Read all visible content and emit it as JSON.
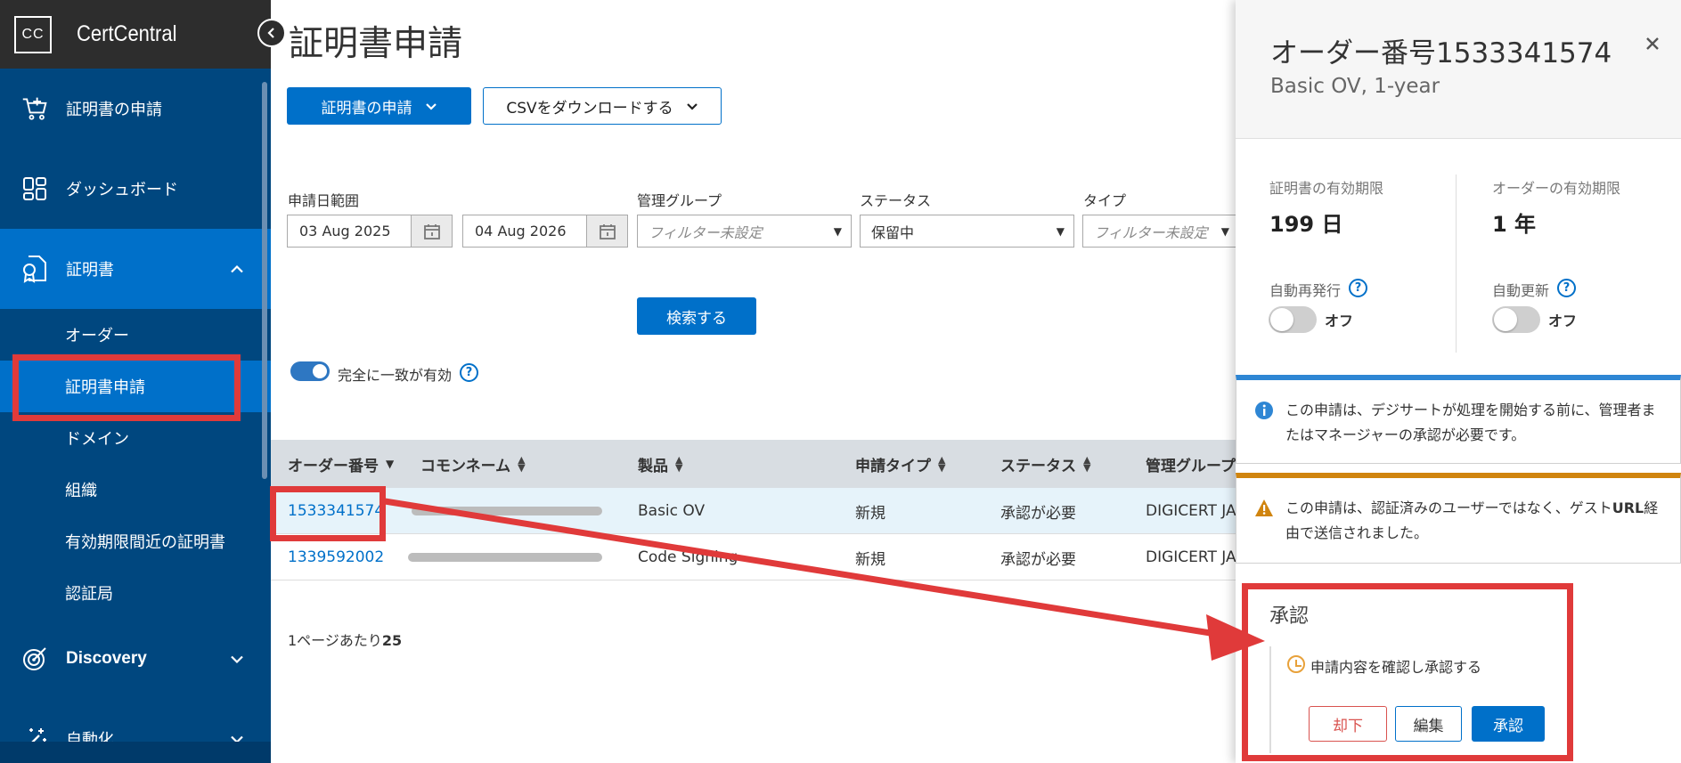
{
  "sidebar": {
    "logo_text": "CC",
    "brand": "CertCentral",
    "items": [
      {
        "label": "証明書の申請",
        "icon": "cart-plus-icon"
      },
      {
        "label": "ダッシュボード",
        "icon": "dashboard-grid-icon"
      },
      {
        "label": "証明書",
        "icon": "certificate-icon",
        "active": true
      }
    ],
    "subitems": [
      "オーダー",
      "証明書申請",
      "ドメイン",
      "組織",
      "有効期限間近の証明書",
      "認証局"
    ],
    "discovery": "Discovery",
    "automation": "自動化"
  },
  "main": {
    "title": "証明書申請",
    "request_button": "証明書の申請",
    "csv_button": "CSVをダウンロードする",
    "filters": {
      "date_range_label": "申請日範囲",
      "date_from": "03 Aug 2025",
      "date_to": "04 Aug 2026",
      "group_label": "管理グループ",
      "group_value": "フィルター未設定",
      "status_label": "ステータス",
      "status_value": "保留中",
      "type_label": "タイプ",
      "type_value": "フィルター未設定"
    },
    "search_button": "検索する",
    "exact_match_label": "完全に一致が有効",
    "table": {
      "columns": [
        "オーダー番号",
        "コモンネーム",
        "製品",
        "申請タイプ",
        "ステータス",
        "管理グループ"
      ],
      "rows": [
        {
          "order": "1533341574",
          "product": "Basic OV",
          "type": "新規",
          "status": "承認が必要",
          "group": "DIGICERT JAP"
        },
        {
          "order": "1339592002",
          "product": "Code Signing",
          "type": "新規",
          "status": "承認が必要",
          "group": "DIGICERT JAP"
        }
      ]
    },
    "per_page_prefix": "1ページあたり",
    "per_page_value": "25"
  },
  "panel": {
    "title": "オーダー番号1533341574",
    "subtitle": "Basic OV, 1-year",
    "cert_validity_label": "証明書の有効期限",
    "cert_validity_value": "199 日",
    "order_validity_label": "オーダーの有効期限",
    "order_validity_value": "1 年",
    "auto_reissue_label": "自動再発行",
    "auto_reissue_state": "オフ",
    "auto_renew_label": "自動更新",
    "auto_renew_state": "オフ",
    "info_message": "この申請は、デジサートが処理を開始する前に、管理者またはマネージャーの承認が必要です。",
    "warning_prefix": "この申請は、認証済みのユーザーではなく、ゲスト",
    "warning_url": "URL",
    "warning_suffix": "経由で送信されました。",
    "approval_title": "承認",
    "approval_step": "申請内容を確認し承認する",
    "reject_button": "却下",
    "edit_button": "編集",
    "approve_button": "承認"
  },
  "colors": {
    "sidebar": "#00477f",
    "accent": "#0070c9",
    "annotation": "#e03a3a",
    "warning": "#d0840e"
  }
}
